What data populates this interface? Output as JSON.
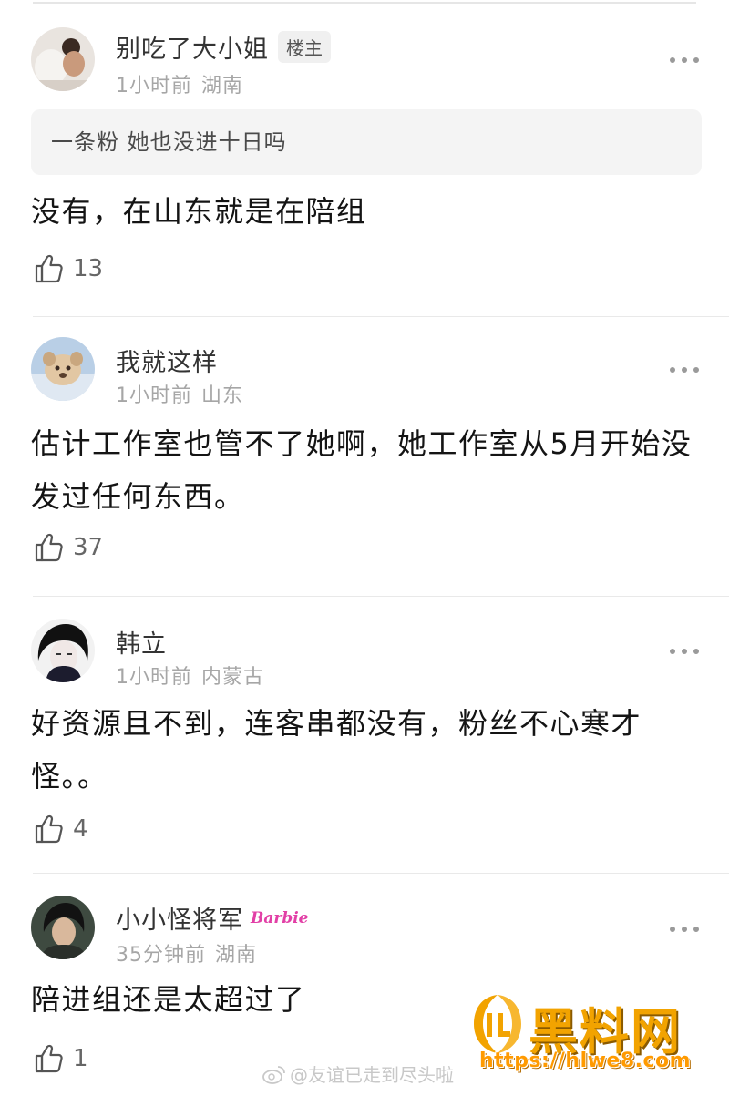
{
  "comments": [
    {
      "name": "别吃了大小姐",
      "badge": "楼主",
      "time": "1小时前",
      "location": "湖南",
      "quote": "一条粉 她也没进十日吗",
      "text": "没有，在山东就是在陪组",
      "likes": "13"
    },
    {
      "name": "我就这样",
      "time": "1小时前",
      "location": "山东",
      "text": "估计工作室也管不了她啊，她工作室从5月开始没发过任何东西。",
      "likes": "37"
    },
    {
      "name": "韩立",
      "time": "1小时前",
      "location": "内蒙古",
      "text": "好资源且不到，连客串都没有，粉丝不心寒才怪。。",
      "likes": "4"
    },
    {
      "name": "小小怪将军",
      "badge": "Barbie",
      "time": "35分钟前",
      "location": "湖南",
      "text": "陪进组还是太超过了",
      "likes": "1"
    }
  ],
  "watermark": {
    "text": "@友谊已走到尽头啦",
    "icon": "weibo-icon"
  },
  "logo": {
    "title": "黑料网",
    "url": "https://hlwe8.com"
  },
  "colors": {
    "meta": "#a6a6a6",
    "quote_bg": "#f4f4f4",
    "logo": "#f2a300"
  }
}
